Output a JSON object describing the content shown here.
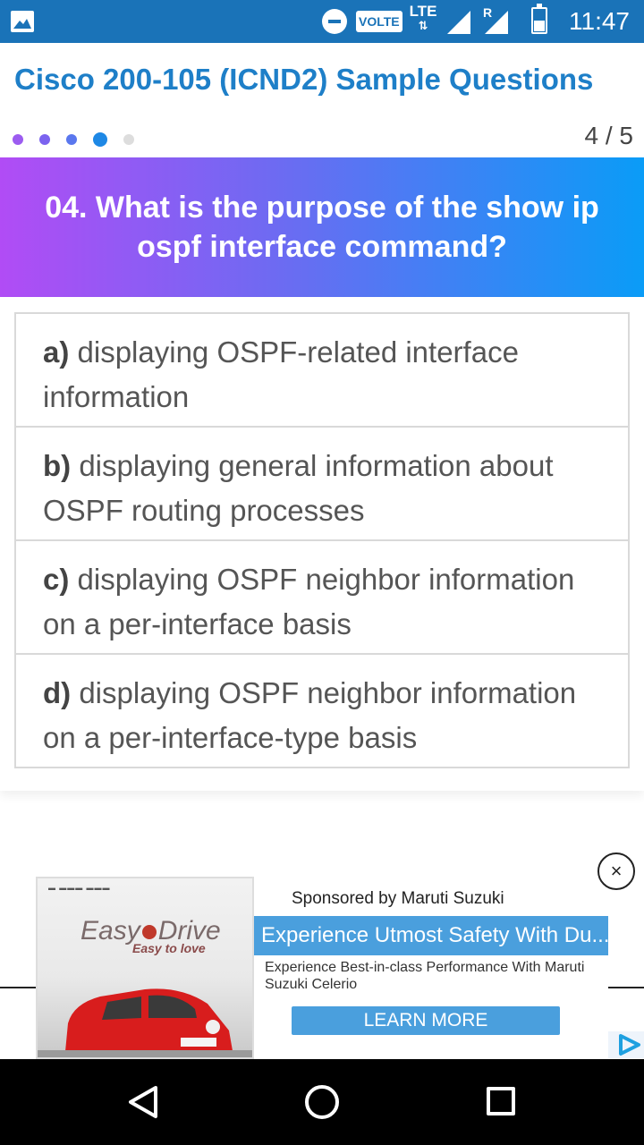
{
  "status_bar": {
    "volte": "VOLTE",
    "network": "LTE",
    "roaming": "R",
    "time": "11:47"
  },
  "title": "Cisco 200-105 (ICND2) Sample Questions",
  "progress": {
    "counter": "4 / 5",
    "current": 4,
    "total": 5,
    "dot_colors": [
      "#9c5cf0",
      "#7b63ef",
      "#5a77ee",
      "#1e88e5",
      "#dddddd"
    ]
  },
  "question": {
    "text": "04. What is the purpose of the show ip ospf interface command?"
  },
  "options": [
    {
      "letter": "a)",
      "text": "displaying OSPF-related interface information"
    },
    {
      "letter": "b)",
      "text": "displaying general information about OSPF routing processes"
    },
    {
      "letter": "c)",
      "text": "displaying OSPF neighbor information on a per-interface basis"
    },
    {
      "letter": "d)",
      "text": "displaying OSPF neighbor information on a per-interface-type basis"
    }
  ],
  "ad": {
    "sponsor": "Sponsored by Maruti Suzuki",
    "headline": "Experience Utmost Safety With Du...",
    "body": "Experience Best-in-class Performance With Maruti Suzuki Celerio",
    "cta": "LEARN MORE",
    "close": "×",
    "image_brand": "Easy",
    "image_brand_2": "Drive",
    "image_tagline": "Easy to love"
  },
  "colors": {
    "accent": "#1e7fc8",
    "status_bar": "#1a73b8",
    "gradient_start": "#b14cf5",
    "gradient_end": "#0a9cf7",
    "ad_blue": "#4a9fdd"
  }
}
